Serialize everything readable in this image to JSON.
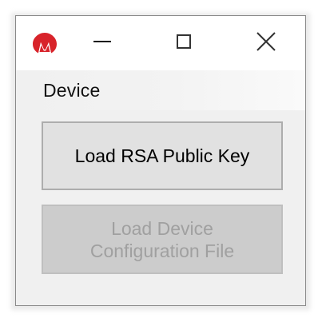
{
  "window": {
    "menu": {
      "device_label": "Device"
    },
    "buttons": {
      "load_rsa_label": "Load RSA Public Key",
      "load_config_line1": "Load Device",
      "load_config_line2": "Configuration File"
    },
    "icons": {
      "app": "microchip-logo-icon",
      "minimize": "minimize-icon",
      "maximize": "maximize-icon",
      "close": "close-icon"
    },
    "colors": {
      "logo_red": "#d8232a",
      "button_bg": "#e1e1e1",
      "disabled_button_bg": "#cccccc",
      "disabled_text": "#a0a0a0"
    }
  }
}
